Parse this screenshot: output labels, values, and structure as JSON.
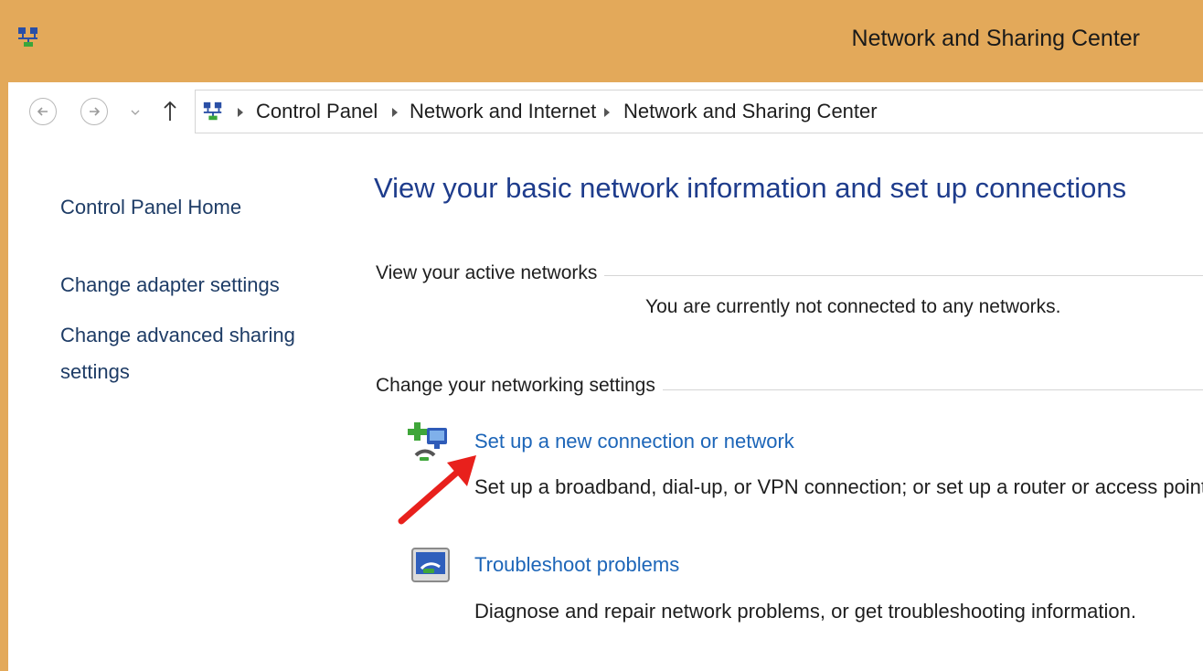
{
  "window": {
    "title": "Network and Sharing Center",
    "accent_color": "#e3a95a"
  },
  "address_bar": {
    "back_icon": "back-arrow-icon",
    "forward_icon": "forward-arrow-icon",
    "up_icon": "up-arrow-icon",
    "breadcrumbs": [
      "Control Panel",
      "Network and Internet",
      "Network and Sharing Center"
    ]
  },
  "sidebar": {
    "items": [
      {
        "label": "Control Panel Home"
      },
      {
        "label": "Change adapter settings"
      },
      {
        "label": "Change advanced sharing"
      },
      {
        "label": "settings"
      }
    ]
  },
  "main": {
    "heading": "View your basic network information and set up connections",
    "heading_color": "#1e3c8c",
    "active_networks": {
      "label": "View your active networks",
      "status": "You are currently not connected to any networks."
    },
    "networking_settings": {
      "label": "Change your networking settings",
      "tasks": [
        {
          "icon": "new-connection-icon",
          "link": "Set up a new connection or network",
          "description": "Set up a broadband, dial-up, or VPN connection; or set up a router or access point."
        },
        {
          "icon": "troubleshoot-icon",
          "link": "Troubleshoot problems",
          "description": "Diagnose and repair network problems, or get troubleshooting information."
        }
      ]
    },
    "link_color": "#1c65b8"
  },
  "annotation": {
    "arrow_color": "#e8201c"
  }
}
